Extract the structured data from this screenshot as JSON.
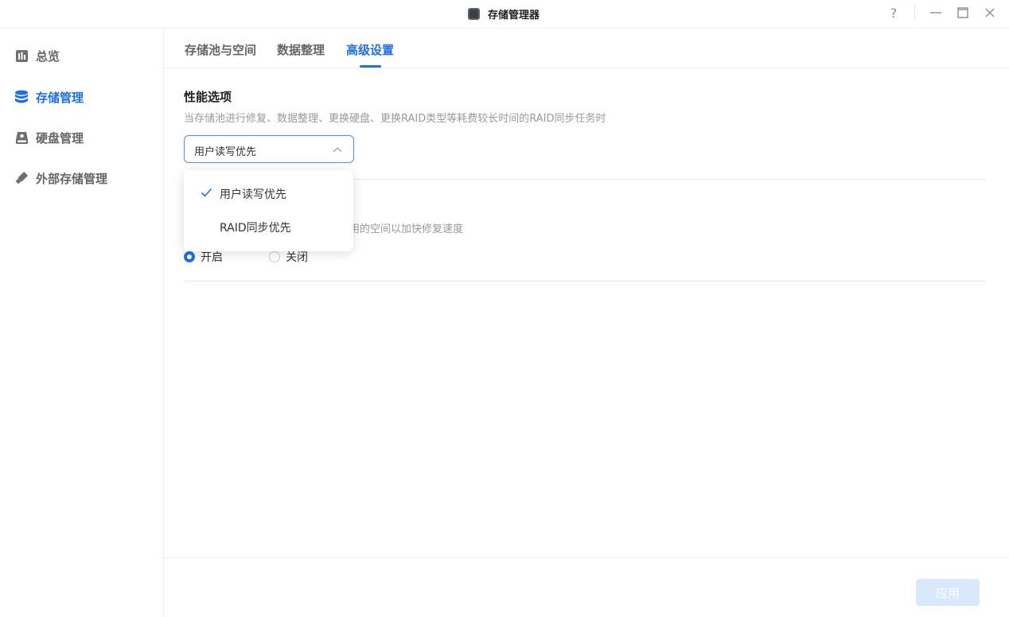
{
  "window": {
    "title": "存储管理器",
    "controls": {
      "help": "?",
      "minimize": "—",
      "close": "✕"
    }
  },
  "sidebar": {
    "items": [
      {
        "label": "总览",
        "icon": "chart-icon",
        "active": false
      },
      {
        "label": "存储管理",
        "icon": "database-icon",
        "active": true
      },
      {
        "label": "硬盘管理",
        "icon": "drive-icon",
        "active": false
      },
      {
        "label": "外部存储管理",
        "icon": "usb-icon",
        "active": false
      }
    ]
  },
  "tabs": [
    {
      "label": "存储池与空间",
      "active": false
    },
    {
      "label": "数据整理",
      "active": false
    },
    {
      "label": "高级设置",
      "active": true
    }
  ],
  "performance": {
    "title": "性能选项",
    "description": "当存储池进行修复、数据整理、更换硬盘、更换RAID类型等耗费较长时间的RAID同步任务时",
    "select_value": "用户读写优先",
    "options": [
      {
        "label": "用户读写优先",
        "selected": true
      },
      {
        "label": "RAID同步优先",
        "selected": false
      }
    ]
  },
  "repair": {
    "description_visible": "使用的空间以加快修复速度",
    "radio_on": "开启",
    "radio_off": "关闭",
    "selected": "开启"
  },
  "footer": {
    "apply_label": "应用",
    "apply_enabled": false
  },
  "colors": {
    "accent": "#1f6fe0",
    "apply_disabled_bg": "#d9e8fd",
    "muted_text": "#999999"
  }
}
